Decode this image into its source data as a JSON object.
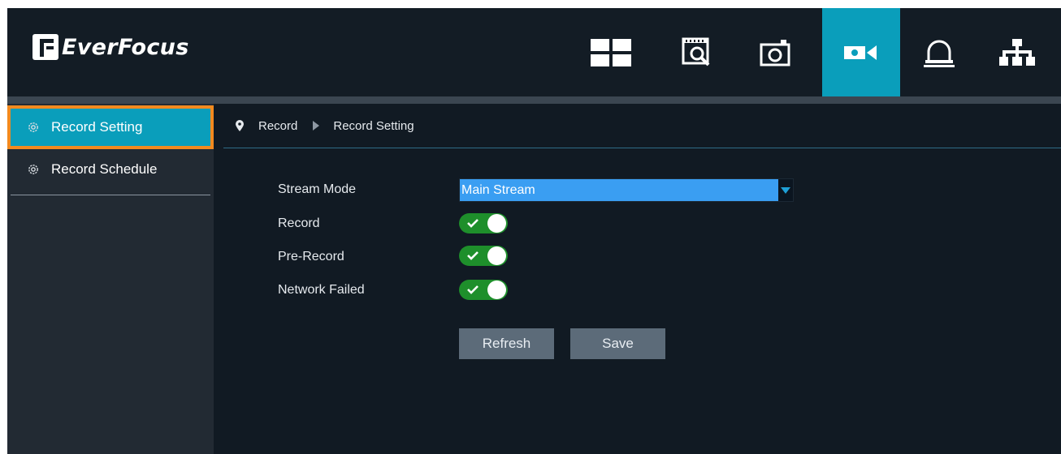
{
  "brand": {
    "name": "EverFocus"
  },
  "nav": [
    {
      "icon": "live-view-grid-icon",
      "active": false
    },
    {
      "icon": "playback-search-icon",
      "active": false
    },
    {
      "icon": "snapshot-camera-icon",
      "active": false
    },
    {
      "icon": "video-camera-icon",
      "active": true
    },
    {
      "icon": "alarm-bell-icon",
      "active": false
    },
    {
      "icon": "network-topology-icon",
      "active": false
    }
  ],
  "sidebar": {
    "items": [
      {
        "label": "Record Setting",
        "icon": "gear-icon",
        "active": true
      },
      {
        "label": "Record Schedule",
        "icon": "gear-icon",
        "active": false
      }
    ]
  },
  "breadcrumb": {
    "root": "Record",
    "current": "Record Setting"
  },
  "form": {
    "stream_mode_label": "Stream Mode",
    "stream_mode_value": "Main Stream",
    "record_label": "Record",
    "record_on": true,
    "prerecord_label": "Pre-Record",
    "prerecord_on": true,
    "network_failed_label": "Network Failed",
    "network_failed_on": true
  },
  "buttons": {
    "refresh": "Refresh",
    "save": "Save"
  },
  "colors": {
    "accent": "#0a9ebb",
    "highlight_outline": "#f28a1f",
    "toggle_on": "#1e8f2b",
    "select_bg": "#3a9ef2",
    "button_bg": "#5c6b79"
  }
}
